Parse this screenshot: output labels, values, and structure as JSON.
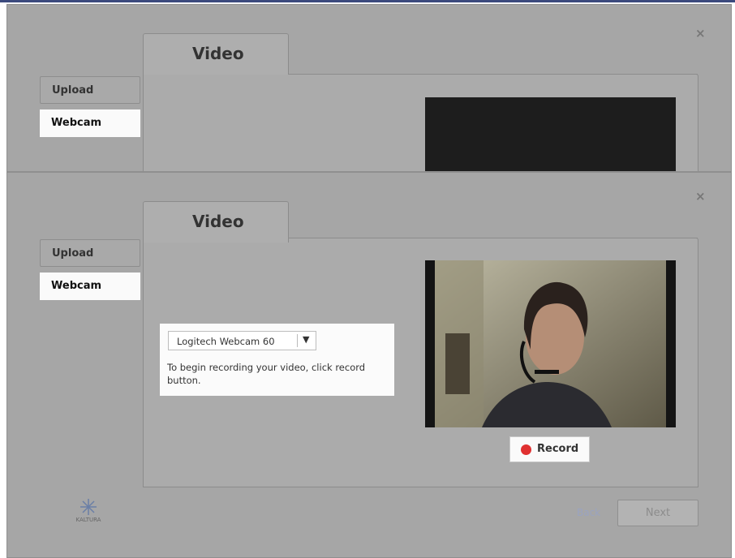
{
  "window": {
    "close_glyph": "×"
  },
  "tabs": {
    "video_label": "Video"
  },
  "sidebar": {
    "upload_label": "Upload",
    "webcam_label": "Webcam"
  },
  "webcam": {
    "device_selected": "Logitech Webcam 60",
    "dropdown_arrow": "▼",
    "instructions": "To begin recording your video, click record button.",
    "record_label": "Record"
  },
  "footer": {
    "logo_text": "KALTURA",
    "back_label": "Back",
    "next_label": "Next"
  },
  "colors": {
    "accent": "#e03030",
    "panel": "#a6a6a6",
    "header_bar": "#3c4a7e"
  }
}
